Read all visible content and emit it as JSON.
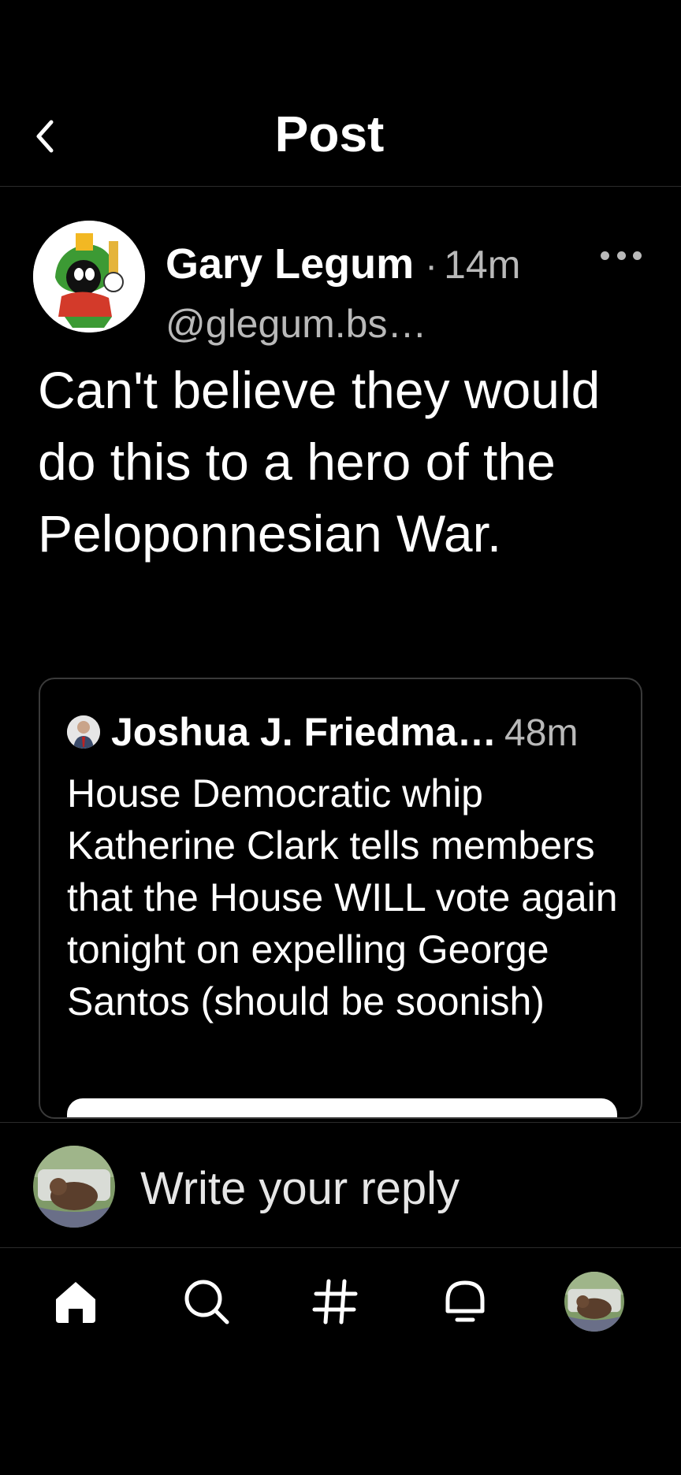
{
  "header": {
    "title": "Post",
    "back_icon": "chevron-left-icon"
  },
  "post": {
    "author_name": "Gary Legum",
    "separator": "·",
    "time": "14m",
    "handle": "@glegum.bs…",
    "text": "Can't believe they would do this to a hero of the Peloponnesian War."
  },
  "quote": {
    "author_name": "Joshua J. Friedma…",
    "time": "48m",
    "text": "House Democratic whip Katherine Clark tells members that the House WILL vote again tonight on expelling George Santos (should be soonish)"
  },
  "reply": {
    "placeholder": "Write your reply"
  },
  "nav": {
    "items": [
      "home-icon",
      "search-icon",
      "hashtag-icon",
      "notifications-icon",
      "profile-avatar"
    ]
  },
  "colors": {
    "background": "#000000",
    "text": "#ffffff",
    "muted": "#b9b9b9",
    "divider": "#2b2b2b"
  }
}
